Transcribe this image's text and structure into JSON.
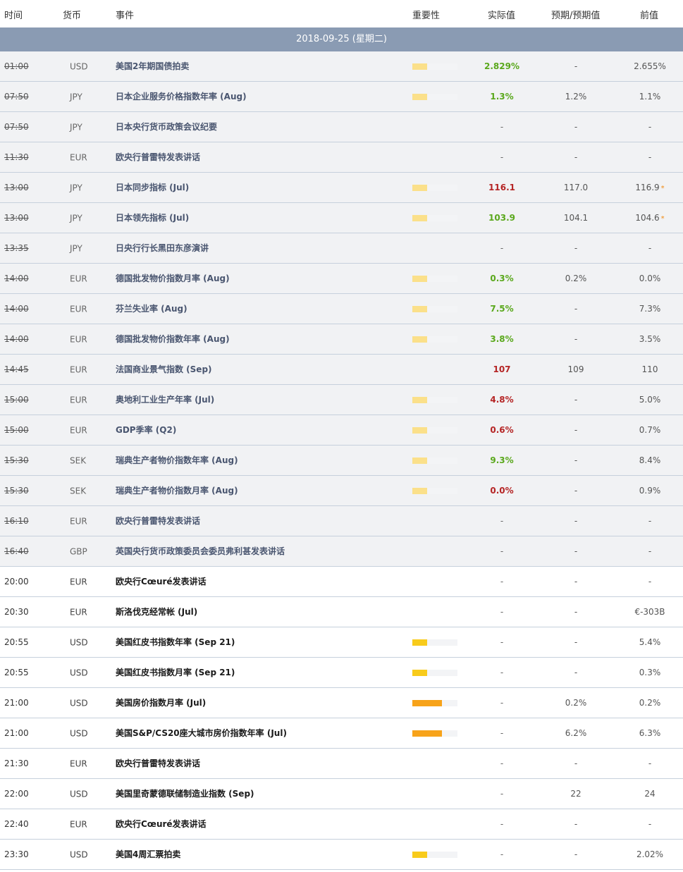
{
  "header": {
    "time": "时间",
    "currency": "货币",
    "event": "事件",
    "importance": "重要性",
    "actual": "实际值",
    "forecast": "预期/预期值",
    "previous": "前值"
  },
  "date_label": "2018-09-25 (星期二)",
  "colors": {
    "imp_low_past": "#fbe08a",
    "imp_low": "#f8cb1b",
    "imp_med": "#f7a31a",
    "actual_up": "#5aa81c",
    "actual_down": "#b52525"
  },
  "events": [
    {
      "time": "01:00",
      "past": true,
      "flag": "us",
      "currency": "USD",
      "event": "美国2年期国债拍卖",
      "importance": 1,
      "actual": "2.829%",
      "trend": "up",
      "forecast": "-",
      "previous": "2.655%",
      "revised": false
    },
    {
      "time": "07:50",
      "past": true,
      "flag": "jp",
      "currency": "JPY",
      "event": "日本企业服务价格指数年率 (Aug)",
      "importance": 1,
      "actual": "1.3%",
      "trend": "up",
      "forecast": "1.2%",
      "previous": "1.1%",
      "revised": false
    },
    {
      "time": "07:50",
      "past": true,
      "flag": "jp",
      "currency": "JPY",
      "event": "日本央行货币政策会议纪要",
      "importance": 0,
      "actual": "-",
      "trend": "none",
      "forecast": "-",
      "previous": "-",
      "revised": false
    },
    {
      "time": "11:30",
      "past": true,
      "flag": "eu",
      "currency": "EUR",
      "event": "欧央行普雷特发表讲话",
      "importance": 0,
      "actual": "-",
      "trend": "none",
      "forecast": "-",
      "previous": "-",
      "revised": false
    },
    {
      "time": "13:00",
      "past": true,
      "flag": "jp",
      "currency": "JPY",
      "event": "日本同步指标 (Jul)",
      "importance": 1,
      "actual": "116.1",
      "trend": "down",
      "forecast": "117.0",
      "previous": "116.9",
      "revised": true
    },
    {
      "time": "13:00",
      "past": true,
      "flag": "jp",
      "currency": "JPY",
      "event": "日本领先指标 (Jul)",
      "importance": 1,
      "actual": "103.9",
      "trend": "up",
      "forecast": "104.1",
      "previous": "104.6",
      "revised": true
    },
    {
      "time": "13:35",
      "past": true,
      "flag": "jp",
      "currency": "JPY",
      "event": "日央行行长黑田东彦演讲",
      "importance": 0,
      "actual": "-",
      "trend": "none",
      "forecast": "-",
      "previous": "-",
      "revised": false
    },
    {
      "time": "14:00",
      "past": true,
      "flag": "de",
      "currency": "EUR",
      "event": "德国批发物价指数月率 (Aug)",
      "importance": 1,
      "actual": "0.3%",
      "trend": "up",
      "forecast": "0.2%",
      "previous": "0.0%",
      "revised": false
    },
    {
      "time": "14:00",
      "past": true,
      "flag": "fi",
      "currency": "EUR",
      "event": "芬兰失业率 (Aug)",
      "importance": 1,
      "actual": "7.5%",
      "trend": "up",
      "forecast": "-",
      "previous": "7.3%",
      "revised": false
    },
    {
      "time": "14:00",
      "past": true,
      "flag": "de",
      "currency": "EUR",
      "event": "德国批发物价指数年率 (Aug)",
      "importance": 1,
      "actual": "3.8%",
      "trend": "up",
      "forecast": "-",
      "previous": "3.5%",
      "revised": false
    },
    {
      "time": "14:45",
      "past": true,
      "flag": "fr",
      "currency": "EUR",
      "event": "法国商业景气指数 (Sep)",
      "importance": 0,
      "actual": "107",
      "trend": "down",
      "forecast": "109",
      "previous": "110",
      "revised": false
    },
    {
      "time": "15:00",
      "past": true,
      "flag": "at",
      "currency": "EUR",
      "event": "奥地利工业生产年率 (Jul)",
      "importance": 1,
      "actual": "4.8%",
      "trend": "down",
      "forecast": "-",
      "previous": "5.0%",
      "revised": false
    },
    {
      "time": "15:00",
      "past": true,
      "flag": "at",
      "currency": "EUR",
      "event": "GDP季率 (Q2)",
      "importance": 1,
      "actual": "0.6%",
      "trend": "down",
      "forecast": "-",
      "previous": "0.7%",
      "revised": false
    },
    {
      "time": "15:30",
      "past": true,
      "flag": "se",
      "currency": "SEK",
      "event": "瑞典生产者物价指数年率 (Aug)",
      "importance": 1,
      "actual": "9.3%",
      "trend": "up",
      "forecast": "-",
      "previous": "8.4%",
      "revised": false
    },
    {
      "time": "15:30",
      "past": true,
      "flag": "se",
      "currency": "SEK",
      "event": "瑞典生产者物价指数月率 (Aug)",
      "importance": 1,
      "actual": "0.0%",
      "trend": "down",
      "forecast": "-",
      "previous": "0.9%",
      "revised": false
    },
    {
      "time": "16:10",
      "past": true,
      "flag": "eu",
      "currency": "EUR",
      "event": "欧央行普雷特发表讲话",
      "importance": 0,
      "actual": "-",
      "trend": "none",
      "forecast": "-",
      "previous": "-",
      "revised": false
    },
    {
      "time": "16:40",
      "past": true,
      "flag": "gb",
      "currency": "GBP",
      "event": "英国央行货币政策委员会委员弗利甚发表讲话",
      "importance": 0,
      "actual": "-",
      "trend": "none",
      "forecast": "-",
      "previous": "-",
      "revised": false
    },
    {
      "time": "20:00",
      "past": false,
      "flag": "eu",
      "currency": "EUR",
      "event": "欧央行Cœuré发表讲话",
      "importance": 0,
      "actual": "-",
      "trend": "none",
      "forecast": "-",
      "previous": "-",
      "revised": false
    },
    {
      "time": "20:30",
      "past": false,
      "flag": "sk",
      "currency": "EUR",
      "event": "斯洛伐克经常帐 (Jul)",
      "importance": 0,
      "actual": "-",
      "trend": "none",
      "forecast": "-",
      "previous": "€-303B",
      "revised": false
    },
    {
      "time": "20:55",
      "past": false,
      "flag": "us",
      "currency": "USD",
      "event": "美国红皮书指数年率 (Sep 21)",
      "importance": 1,
      "actual": "-",
      "trend": "none",
      "forecast": "-",
      "previous": "5.4%",
      "revised": false
    },
    {
      "time": "20:55",
      "past": false,
      "flag": "us",
      "currency": "USD",
      "event": "美国红皮书指数月率 (Sep 21)",
      "importance": 1,
      "actual": "-",
      "trend": "none",
      "forecast": "-",
      "previous": "0.3%",
      "revised": false
    },
    {
      "time": "21:00",
      "past": false,
      "flag": "us",
      "currency": "USD",
      "event": "美国房价指数月率 (Jul)",
      "importance": 2,
      "actual": "-",
      "trend": "none",
      "forecast": "0.2%",
      "previous": "0.2%",
      "revised": false
    },
    {
      "time": "21:00",
      "past": false,
      "flag": "us",
      "currency": "USD",
      "event": "美国S&P/CS20座大城市房价指数年率 (Jul)",
      "importance": 2,
      "actual": "-",
      "trend": "none",
      "forecast": "6.2%",
      "previous": "6.3%",
      "revised": false
    },
    {
      "time": "21:30",
      "past": false,
      "flag": "eu",
      "currency": "EUR",
      "event": "欧央行普雷特发表讲话",
      "importance": 0,
      "actual": "-",
      "trend": "none",
      "forecast": "-",
      "previous": "-",
      "revised": false
    },
    {
      "time": "22:00",
      "past": false,
      "flag": "us",
      "currency": "USD",
      "event": "美国里奇蒙德联储制造业指数 (Sep)",
      "importance": 0,
      "actual": "-",
      "trend": "none",
      "forecast": "22",
      "previous": "24",
      "revised": false
    },
    {
      "time": "22:40",
      "past": false,
      "flag": "eu",
      "currency": "EUR",
      "event": "欧央行Cœuré发表讲话",
      "importance": 0,
      "actual": "-",
      "trend": "none",
      "forecast": "-",
      "previous": "-",
      "revised": false
    },
    {
      "time": "23:30",
      "past": false,
      "flag": "us",
      "currency": "USD",
      "event": "美国4周汇票拍卖",
      "importance": 1,
      "actual": "-",
      "trend": "none",
      "forecast": "-",
      "previous": "2.02%",
      "revised": false
    }
  ]
}
